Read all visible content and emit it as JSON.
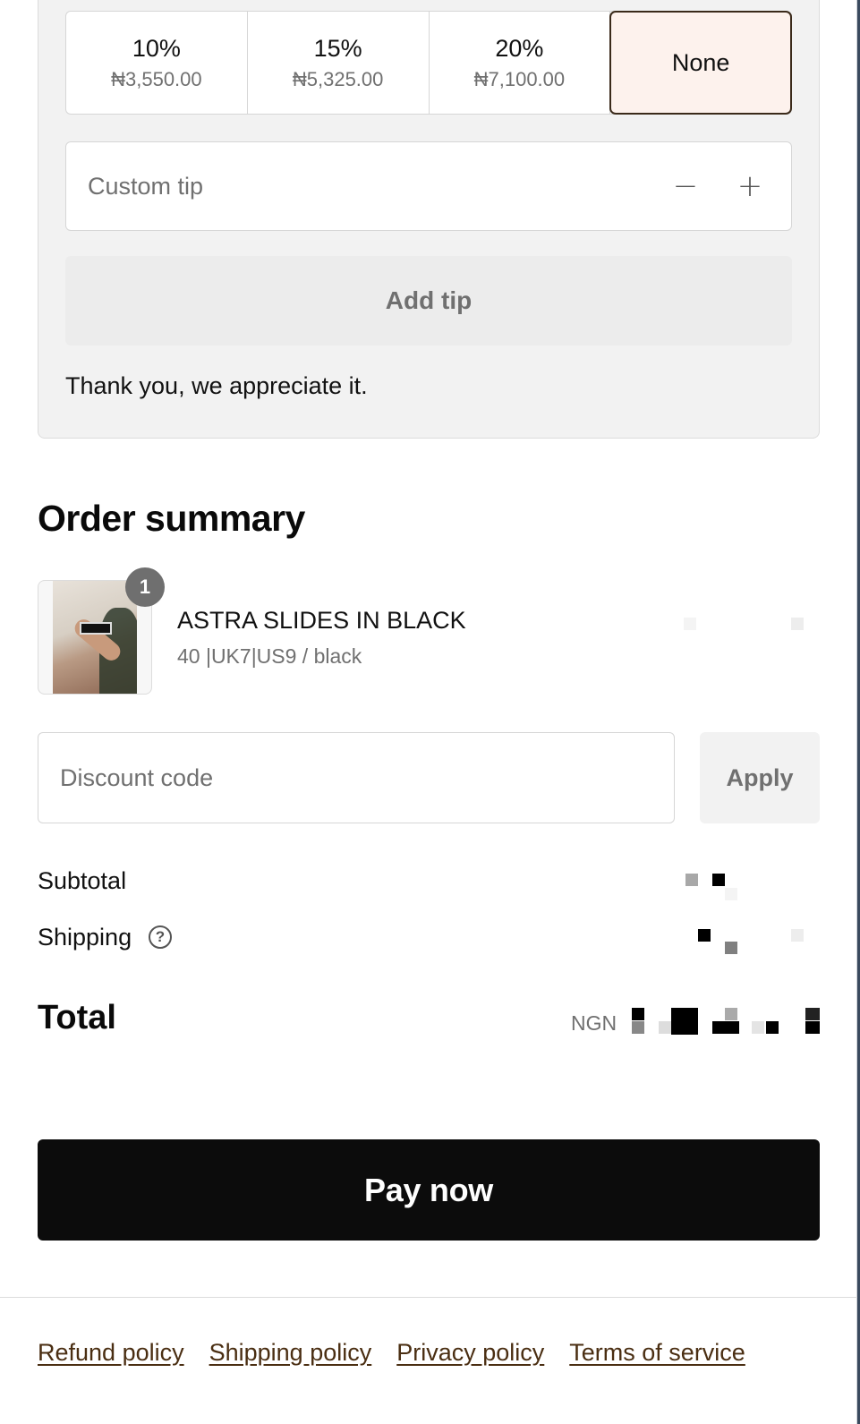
{
  "tip": {
    "options": [
      {
        "percent": "10%",
        "amount": "₦3,550.00"
      },
      {
        "percent": "15%",
        "amount": "₦5,325.00"
      },
      {
        "percent": "20%",
        "amount": "₦7,100.00"
      },
      {
        "percent": "None",
        "amount": ""
      }
    ],
    "selected": "None",
    "custom_placeholder": "Custom tip",
    "decrement_symbol": "−",
    "increment_symbol": "+",
    "add_label": "Add tip",
    "thanks_message": "Thank you, we appreciate it."
  },
  "order_summary": {
    "title": "Order summary",
    "item": {
      "quantity": "1",
      "name": "ASTRA SLIDES IN BLACK",
      "variant": "40 |UK7|US9 / black"
    }
  },
  "discount": {
    "placeholder": "Discount code",
    "apply_label": "Apply"
  },
  "totals": {
    "subtotal_label": "Subtotal",
    "shipping_label": "Shipping",
    "help_symbol": "?",
    "total_label": "Total",
    "currency": "NGN"
  },
  "pay_label": "Pay now",
  "footer": {
    "links": [
      "Refund policy",
      "Shipping policy",
      "Privacy policy",
      "Terms of service"
    ]
  },
  "colors": {
    "selected_border": "#3a2a1a",
    "selected_bg": "#fdf2ed",
    "pay_bg": "#0c0c0c",
    "link": "#4a2e12"
  }
}
